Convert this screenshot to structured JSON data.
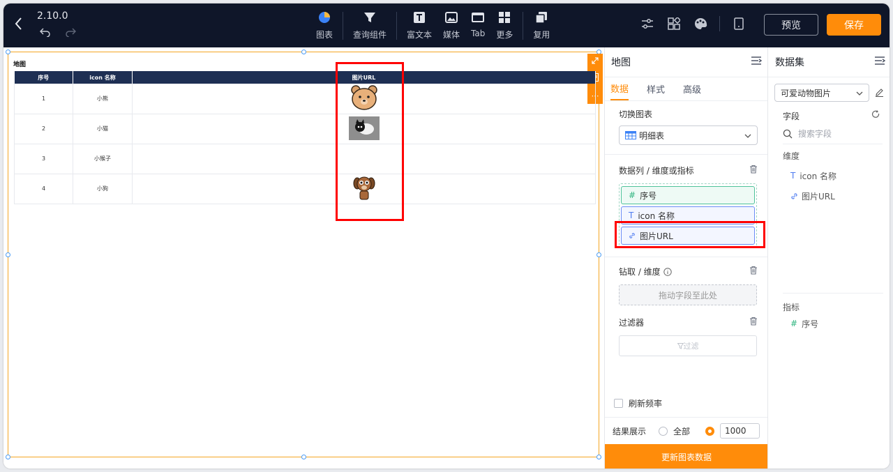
{
  "header": {
    "version": "2.10.0",
    "tools": [
      {
        "label": "图表",
        "icon": "chart-pie-icon"
      },
      {
        "label": "查询组件",
        "icon": "filter-funnel-icon"
      },
      {
        "label": "富文本",
        "icon": "text-box-icon"
      },
      {
        "label": "媒体",
        "icon": "image-icon"
      },
      {
        "label": "Tab",
        "icon": "tab-icon"
      },
      {
        "label": "更多",
        "icon": "grid-icon"
      },
      {
        "label": "复用",
        "icon": "copy-icon"
      }
    ],
    "preview_label": "预览",
    "save_label": "保存"
  },
  "widget": {
    "title": "地图",
    "columns": [
      "序号",
      "icon 名称",
      "图片URL"
    ],
    "rows": [
      {
        "index": "1",
        "name": "小熊",
        "image": "bear-image"
      },
      {
        "index": "2",
        "name": "小猫",
        "image": "cat-image"
      },
      {
        "index": "3",
        "name": "小猴子",
        "image": ""
      },
      {
        "index": "4",
        "name": "小狗",
        "image": "dog-image"
      }
    ]
  },
  "config_panel": {
    "title": "地图",
    "tabs": [
      "数据",
      "样式",
      "高级"
    ],
    "switch_chart_label": "切换图表",
    "chart_type": "明细表",
    "columns_label": "数据列 / 维度或指标",
    "fields": [
      {
        "label": "序号",
        "icon": "#"
      },
      {
        "label": "icon 名称",
        "icon": "T"
      },
      {
        "label": "图片URL",
        "icon": "link"
      }
    ],
    "drill_label": "钻取 / 维度",
    "drill_placeholder": "拖动字段至此处",
    "filter_label": "过滤器",
    "filter_button": "过滤",
    "refresh_label": "刷新频率",
    "result_label": "结果展示",
    "result_all": "全部",
    "result_limit": "1000",
    "update_button": "更新图表数据"
  },
  "dataset_panel": {
    "title": "数据集",
    "dataset": "可爱动物图片",
    "fields_label": "字段",
    "search_placeholder": "搜索字段",
    "dimension_label": "维度",
    "dimensions": [
      "icon 名称",
      "图片URL"
    ],
    "measure_label": "指标",
    "measures": [
      "序号"
    ]
  },
  "colors": {
    "accent": "#ff8c0a",
    "topbar": "#0f1629",
    "table_header": "#1e2f53",
    "highlight": "#ff0000"
  }
}
